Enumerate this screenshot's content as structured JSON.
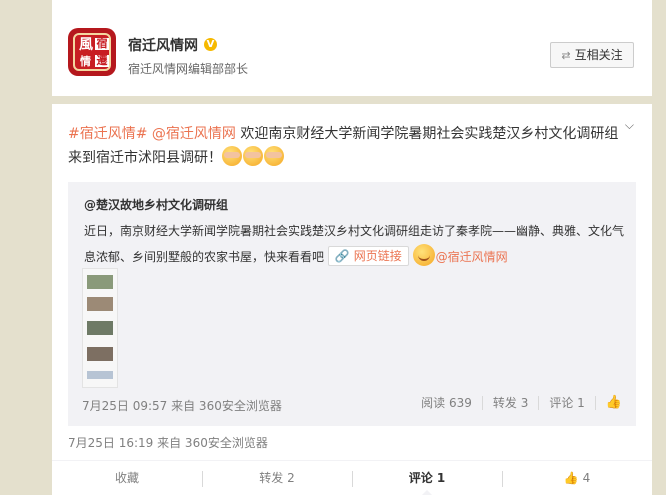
{
  "profile": {
    "avatar_chars": [
      "風",
      "宿",
      "情",
      "遷"
    ],
    "name": "宿迁风情网",
    "verified_icon": "verified-v-icon",
    "description": "宿迁风情网编辑部部长",
    "follow_label": "互相关注"
  },
  "post": {
    "hashtag": "#宿迁风情#",
    "mention": "@宿迁风情网",
    "text": "欢迎南京财经大学新闻学院暑期社会实践楚汉乡村文化调研组来到宿迁市沭阳县调研！",
    "meta": "7月25日 16:19 来自 360安全浏览器"
  },
  "repost": {
    "author": "@楚汉故地乡村文化调研组",
    "text": "近日，南京财经大学新闻学院暑期社会实践楚汉乡村文化调研组走访了秦孝院——幽静、典雅、文化气息浓郁、乡间别墅般的农家书屋，快来看看吧",
    "link_label": "网页链接",
    "mention": "@宿迁风情网",
    "meta": "7月25日 09:57 来自 360安全浏览器",
    "reads": "阅读 639",
    "reposts": "转发 3",
    "comments": "评论 1"
  },
  "actions": {
    "favorite": "收藏",
    "repost": "转发 2",
    "comment": "评论 1",
    "like": "4"
  }
}
